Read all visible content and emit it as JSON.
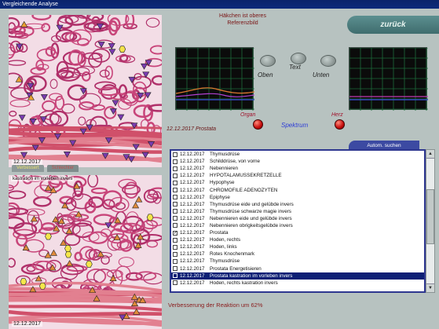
{
  "window": {
    "title": "Vergleichende Analyse"
  },
  "left": {
    "tabs": {
      "active_label": "Verbessert",
      "other_label": "Schlechter"
    },
    "top_image": {
      "date": "12.12.2017"
    },
    "bottom_image": {
      "caption": "kastration im vorleben invers",
      "date": "12.12.2017"
    }
  },
  "header": {
    "reference_line1": "Häkchen ist oberes",
    "reference_line2": "Referenzbild"
  },
  "back_button": {
    "label": "zurück"
  },
  "spectrum": {
    "oben_label": "Oben",
    "text_label": "Text",
    "unten_label": "Unten",
    "organ_label": "Organ",
    "herz_label": "Herz",
    "spektrum_label": "Spektrum"
  },
  "selected_item": "12.12.2017 Prostata",
  "auto_search": {
    "label": "Autom. suchen"
  },
  "list": {
    "items": [
      {
        "checked": false,
        "date": "12.12.2017",
        "text": "Thymusdrüse"
      },
      {
        "checked": false,
        "date": "12.12.2017",
        "text": "Schilddrüse, von vorne"
      },
      {
        "checked": false,
        "date": "12.12.2017",
        "text": "Nebennieren"
      },
      {
        "checked": false,
        "date": "12.12.2017",
        "text": "HYPOTALAMUSSEKRETZELLE"
      },
      {
        "checked": false,
        "date": "12.12.2017",
        "text": "Hypophyse"
      },
      {
        "checked": false,
        "date": "12.12.2017",
        "text": "CHROMOFILE ADENOZYTEN"
      },
      {
        "checked": false,
        "date": "12.12.2017",
        "text": "Epiphyse"
      },
      {
        "checked": false,
        "date": "12.12.2017",
        "text": "Thymusdrüse  eide und gelübde invers"
      },
      {
        "checked": false,
        "date": "12.12.2017",
        "text": "Thymusdrüse  schwarze magie invers"
      },
      {
        "checked": false,
        "date": "12.12.2017",
        "text": "Nebennieren  eide und gelübde invers"
      },
      {
        "checked": false,
        "date": "12.12.2017",
        "text": "Nebennieren  obrigkeitsgelübde invers"
      },
      {
        "checked": true,
        "date": "12.12.2017",
        "text": "Prostata"
      },
      {
        "checked": false,
        "date": "12.12.2017",
        "text": "Hoden, rechts"
      },
      {
        "checked": false,
        "date": "12.12.2017",
        "text": "Hoden, links"
      },
      {
        "checked": false,
        "date": "12.12.2017",
        "text": "Rotes Knochenmark"
      },
      {
        "checked": false,
        "date": "12.12.2017",
        "text": "Thymusdrüse"
      },
      {
        "checked": false,
        "date": "12.12.2017",
        "text": "Prostata  Energetisieren"
      },
      {
        "checked": false,
        "date": "12.12.2017",
        "text": "Prostata  kastration im vorleben invers",
        "selected": true
      },
      {
        "checked": false,
        "date": "12.12.2017",
        "text": "Hoden, rechts  kastration invers"
      }
    ]
  },
  "result": {
    "text": "Verbesserung der Reaktion um 62%"
  },
  "colors": {
    "accent_navy": "#0c1f75",
    "back_button": "#4f7f80",
    "led_red": "#c40b0b",
    "label_dark_red": "#7a1414"
  }
}
